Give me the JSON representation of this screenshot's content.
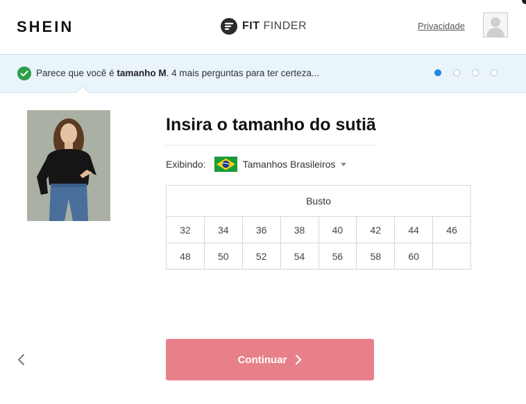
{
  "header": {
    "logo": "SHEIN",
    "fitfinder_fit": "FIT",
    "fitfinder_finder": "FINDER",
    "privacy_link": "Privacidade",
    "avatar_icon": "user-silhouette-icon"
  },
  "banner": {
    "text_before": "Parece que você é ",
    "text_bold": "tamanho M",
    "text_after": ". 4 mais perguntas para ter certeza...",
    "progress_total": 4,
    "progress_current": 1,
    "check_color": "#2e9e4a"
  },
  "main": {
    "title": "Insira o tamanho do sutiã",
    "showing_label": "Exibindo:",
    "size_system": "Tamanhos Brasileiros",
    "flag_icon": "brazil-flag-icon",
    "table_header": "Busto",
    "rows": [
      [
        "32",
        "34",
        "36",
        "38",
        "40",
        "42",
        "44",
        "46"
      ],
      [
        "48",
        "50",
        "52",
        "54",
        "56",
        "58",
        "60",
        ""
      ]
    ]
  },
  "footer": {
    "continue_label": "Continuar",
    "continue_color": "#e88089",
    "back_icon": "chevron-left-icon"
  }
}
